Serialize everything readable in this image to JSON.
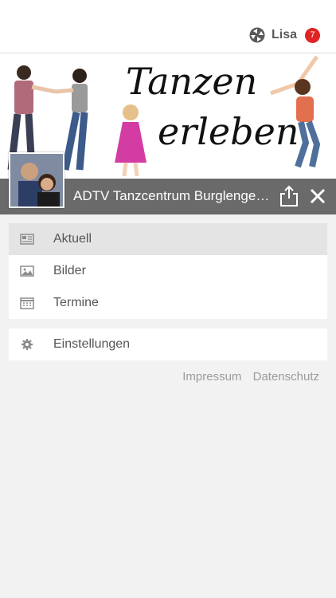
{
  "header": {
    "user_name": "Lisa",
    "notification_count": "7"
  },
  "banner": {
    "title_line1": "Tanzen",
    "title_line2": "erleben"
  },
  "app": {
    "title": "ADTV Tanzcentrum Burglengenfeld"
  },
  "menu": [
    {
      "label": "Aktuell",
      "icon": "newspaper-icon",
      "active": true
    },
    {
      "label": "Bilder",
      "icon": "image-icon",
      "active": false
    },
    {
      "label": "Termine",
      "icon": "calendar-icon",
      "active": false
    }
  ],
  "settings": {
    "label": "Einstellungen",
    "icon": "gear-icon"
  },
  "footer": {
    "impressum": "Impressum",
    "datenschutz": "Datenschutz"
  },
  "colors": {
    "badge": "#e02424",
    "appbar": "#6a6a6a",
    "active_item": "#e4e4e4"
  }
}
